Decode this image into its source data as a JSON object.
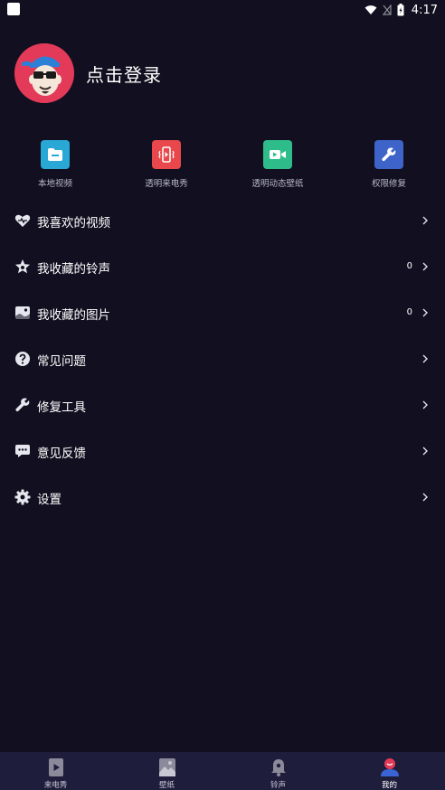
{
  "status_bar": {
    "time": "4:17"
  },
  "profile": {
    "login_label": "点击登录"
  },
  "quick_actions": [
    {
      "label": "本地视频",
      "color": "#29a8d6",
      "icon": "folder-icon"
    },
    {
      "label": "透明来电秀",
      "color": "#e8474b",
      "icon": "phone-vibrate-icon"
    },
    {
      "label": "透明动态壁纸",
      "color": "#2ebd8a",
      "icon": "video-camera-icon"
    },
    {
      "label": "权限修复",
      "color": "#3e63c9",
      "icon": "wrench-icon"
    }
  ],
  "menu": [
    {
      "label": "我喜欢的视频",
      "count": "",
      "icon": "heart-icon"
    },
    {
      "label": "我收藏的铃声",
      "count": "0",
      "icon": "star-icon"
    },
    {
      "label": "我收藏的图片",
      "count": "0",
      "icon": "image-icon"
    },
    {
      "label": "常见问题",
      "count": "",
      "icon": "question-icon"
    },
    {
      "label": "修复工具",
      "count": "",
      "icon": "wrench-icon"
    },
    {
      "label": "意见反馈",
      "count": "",
      "icon": "chat-icon"
    },
    {
      "label": "设置",
      "count": "",
      "icon": "gear-icon"
    }
  ],
  "tabs": [
    {
      "label": "来电秀",
      "icon": "play-icon",
      "active": false
    },
    {
      "label": "壁纸",
      "icon": "wallpaper-icon",
      "active": false
    },
    {
      "label": "铃声",
      "icon": "bell-icon",
      "active": false
    },
    {
      "label": "我的",
      "icon": "profile-icon",
      "active": true
    }
  ],
  "colors": {
    "background": "#121020",
    "tabbar": "#1f1d3c",
    "avatar_bg": "#e23a58"
  }
}
